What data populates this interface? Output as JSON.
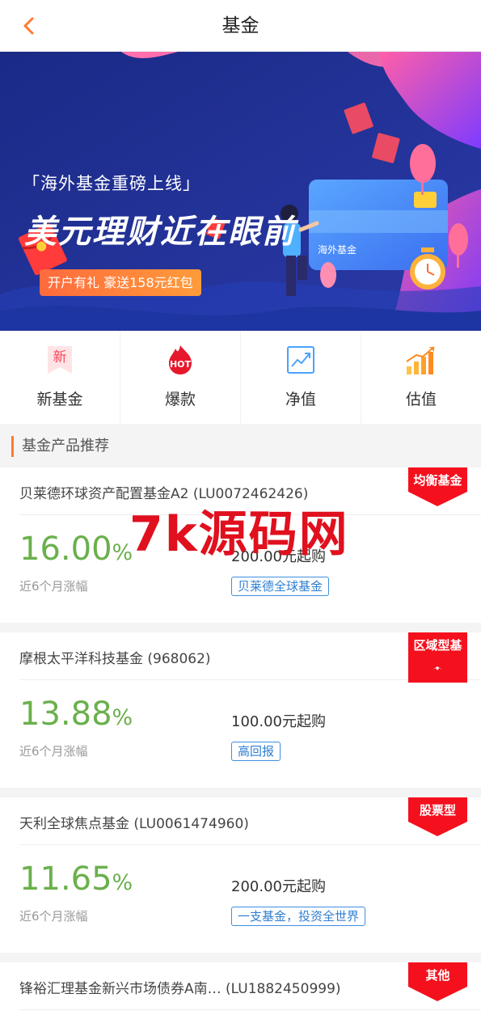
{
  "header": {
    "title": "基金",
    "back_icon": "chevron-left-icon"
  },
  "banner": {
    "subtitle": "「海外基金重磅上线」",
    "title": "美元理财近在眼前",
    "promo": "开户有礼 豪送158元红包",
    "card_label": "海外基金"
  },
  "quick_nav": [
    {
      "label": "新基金",
      "icon": "new-badge-icon",
      "icon_text": "新"
    },
    {
      "label": "爆款",
      "icon": "hot-flame-icon",
      "icon_text": "HOT"
    },
    {
      "label": "净值",
      "icon": "line-chart-icon"
    },
    {
      "label": "估值",
      "icon": "bar-chart-icon"
    }
  ],
  "section": {
    "title": "基金产品推荐"
  },
  "watermark": "7k源码网",
  "funds": [
    {
      "name": "贝莱德环球资产配置基金A2 (LU0072462426)",
      "rate": "16.00",
      "rate_unit": "%",
      "rate_label": "近6个月涨幅",
      "min_buy": "200.00元起购",
      "tag": "贝莱德全球基金",
      "type": "均衡基金"
    },
    {
      "name": "摩根太平洋科技基金 (968062)",
      "rate": "13.88",
      "rate_unit": "%",
      "rate_label": "近6个月涨幅",
      "min_buy": "100.00元起购",
      "tag": "高回报",
      "type": "区域型基"
    },
    {
      "name": "天利全球焦点基金 (LU0061474960)",
      "rate": "11.65",
      "rate_unit": "%",
      "rate_label": "近6个月涨幅",
      "min_buy": "200.00元起购",
      "tag": "一支基金，投资全世界",
      "type": "股票型"
    },
    {
      "name": "锋裕汇理基金新兴市场债券A南…  (LU1882450999)",
      "type": "其他"
    }
  ],
  "colors": {
    "accent": "#ff7a2f",
    "rate_green": "#6ab04c",
    "tag_blue": "#2f7fd3",
    "type_red": "#f5101d",
    "banner_bg": "#1c2d8c"
  }
}
